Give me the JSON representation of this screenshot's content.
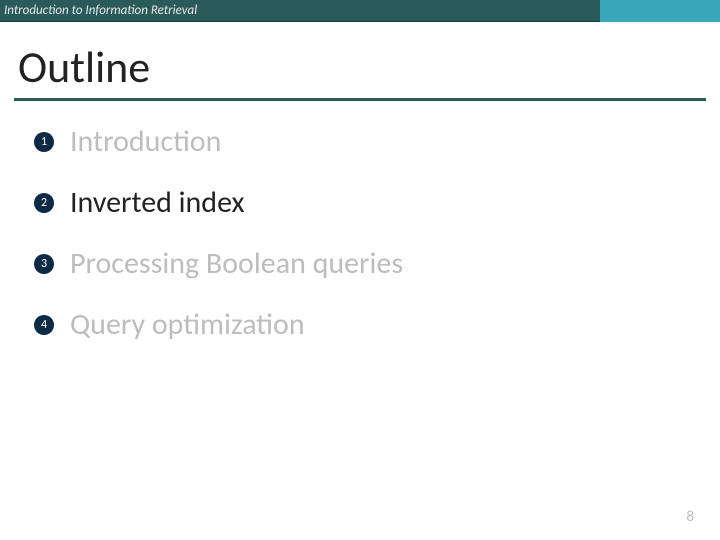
{
  "header": {
    "title": "Introduction to Information Retrieval"
  },
  "slide": {
    "title": "Outline",
    "page_number": "8"
  },
  "outline": {
    "items": [
      {
        "num": "1",
        "label": "Introduction",
        "active": false
      },
      {
        "num": "2",
        "label": "Inverted index",
        "active": true
      },
      {
        "num": "3",
        "label": "Processing Boolean queries",
        "active": false
      },
      {
        "num": "4",
        "label": "Query optimization",
        "active": false
      }
    ]
  }
}
